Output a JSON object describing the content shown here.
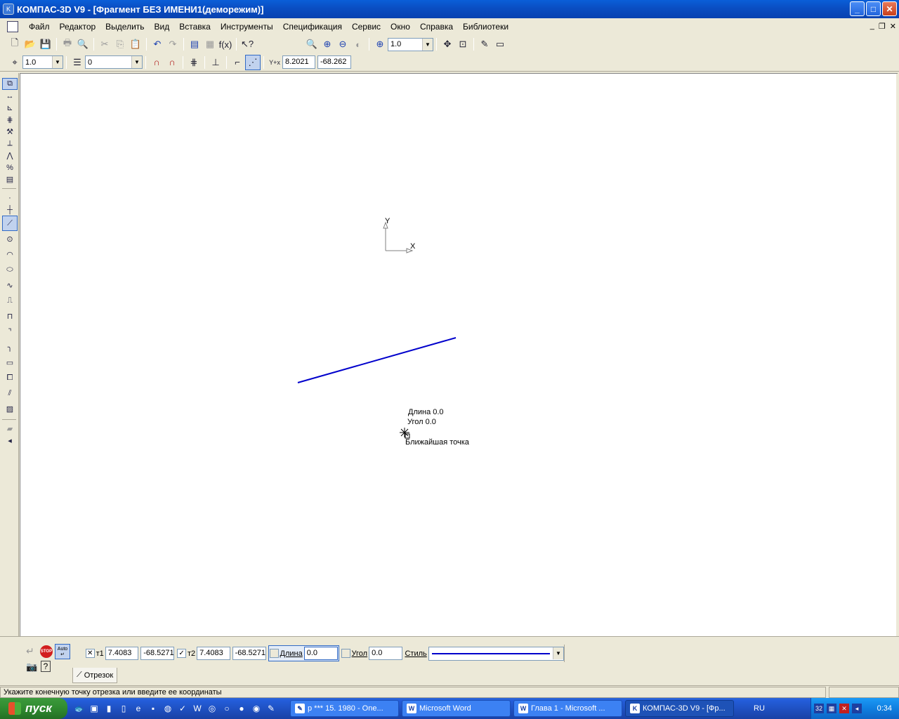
{
  "window": {
    "title": "КОМПАС-3D V9 - [Фрагмент БЕЗ ИМЕНИ1(деморежим)]"
  },
  "menu": [
    "Файл",
    "Редактор",
    "Выделить",
    "Вид",
    "Вставка",
    "Инструменты",
    "Спецификация",
    "Сервис",
    "Окно",
    "Справка",
    "Библиотеки"
  ],
  "toolbar": {
    "zoom_value": "1.0"
  },
  "toolbar2": {
    "step_value": "1.0",
    "layer_value": "0",
    "coord_x": "8.2021",
    "coord_y": "-68.262"
  },
  "canvas": {
    "axis_y": "Y",
    "axis_x": "X",
    "hint_length": "Длина 0.0",
    "hint_angle": "Угол  0.0",
    "hint_snap": "Ближайшая точка",
    "line_color": "#0000cc"
  },
  "properties": {
    "t1_label": "т1",
    "t1_x": "7.4083",
    "t1_y": "-68.5271",
    "t2_label": "т2",
    "t2_x": "7.4083",
    "t2_y": "-68.5271",
    "length_label": "Длина",
    "length_value": "0.0",
    "angle_label": "Угол",
    "angle_value": "0.0",
    "style_label": "Стиль",
    "tab_label": "Отрезок",
    "auto_label": "Auto",
    "stop_label": "STOP"
  },
  "status": {
    "message": "Укажите конечную точку отрезка или введите ее координаты"
  },
  "taskbar": {
    "start": "пуск",
    "tasks": [
      "р *** 15. 1980 - One...",
      "Microsoft Word",
      "Глава 1 - Microsoft ...",
      "КОМПАС-3D V9 - [Фр..."
    ],
    "lang": "RU",
    "clock": "0:34"
  }
}
